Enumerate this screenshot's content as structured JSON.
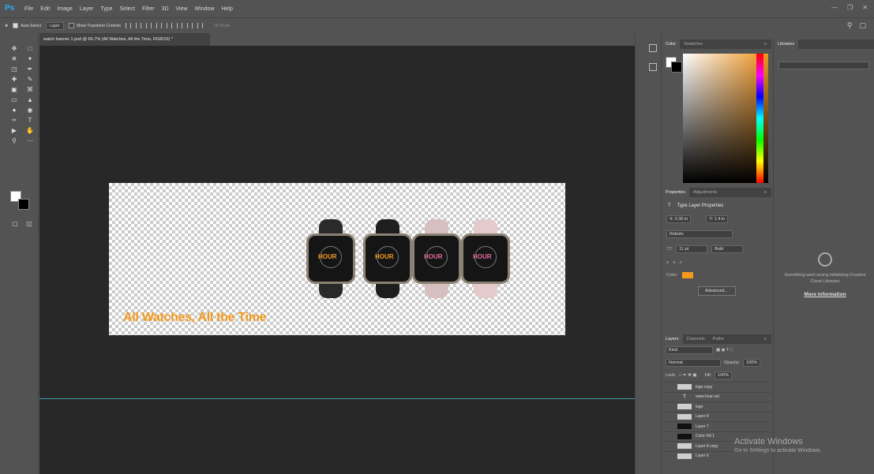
{
  "app": {
    "logo": "Ps"
  },
  "menu": [
    "File",
    "Edit",
    "Image",
    "Layer",
    "Type",
    "Select",
    "Filter",
    "3D",
    "View",
    "Window",
    "Help"
  ],
  "options": {
    "auto_select": "Auto-Select",
    "layer_select": "Layer",
    "transform": "Show Transform Controls",
    "mode": "3D Mode:"
  },
  "document": {
    "tab": "watch banner 1.psd @ 66.7% (All Watches, All the Time, RGB/16) *"
  },
  "canvas": {
    "tagline": "All Watches, All the Time",
    "watches": [
      {
        "brand": "HOUR",
        "strap_color": "#2a2a2a",
        "dial_color": "#f39a1e"
      },
      {
        "brand": "HOUR",
        "strap_color": "#1e1e1e",
        "dial_color": "#f39a1e"
      },
      {
        "brand": "HOUR",
        "strap_color": "#d8bfbf",
        "dial_color": "#e06aa0"
      },
      {
        "brand": "HOUR",
        "strap_color": "#e4caca",
        "dial_color": "#e06aa0"
      }
    ]
  },
  "color_panel": {
    "tabs": [
      "Color",
      "Swatches"
    ]
  },
  "properties_panel": {
    "tabs": [
      "Properties",
      "Adjustments"
    ],
    "title": "Type Layer Properties",
    "x": "X: 0.36 in",
    "y": "Y: 1.4 in",
    "font": "Roboto",
    "size": "11 pt",
    "style": "Bold",
    "color_label": "Color:",
    "color": "#f39a1e",
    "advanced": "Advanced..."
  },
  "layers_panel": {
    "tabs": [
      "Layers",
      "Channels",
      "Paths"
    ],
    "kind": "Kind",
    "blend": "Normal",
    "opacity_label": "Opacity:",
    "opacity": "100%",
    "lock": "Lock:",
    "fill_label": "Fill:",
    "fill": "100%",
    "layers": [
      {
        "name": "logo copy",
        "thumb": "img"
      },
      {
        "name": "www.hour.net",
        "thumb": "T"
      },
      {
        "name": "logo",
        "thumb": "img"
      },
      {
        "name": "Layer 8",
        "thumb": "img"
      },
      {
        "name": "Layer 7",
        "thumb": "black"
      },
      {
        "name": "Color Fill 1",
        "thumb": "black"
      },
      {
        "name": "Layer 8 copy",
        "thumb": "img"
      },
      {
        "name": "Layer 6",
        "thumb": "img"
      }
    ]
  },
  "libraries": {
    "title": "Libraries",
    "message": "Something went wrong initializing Creative Cloud Libraries",
    "link": "More information"
  },
  "watermark": {
    "line1": "Activate Windows",
    "line2": "Go to Settings to activate Windows."
  }
}
